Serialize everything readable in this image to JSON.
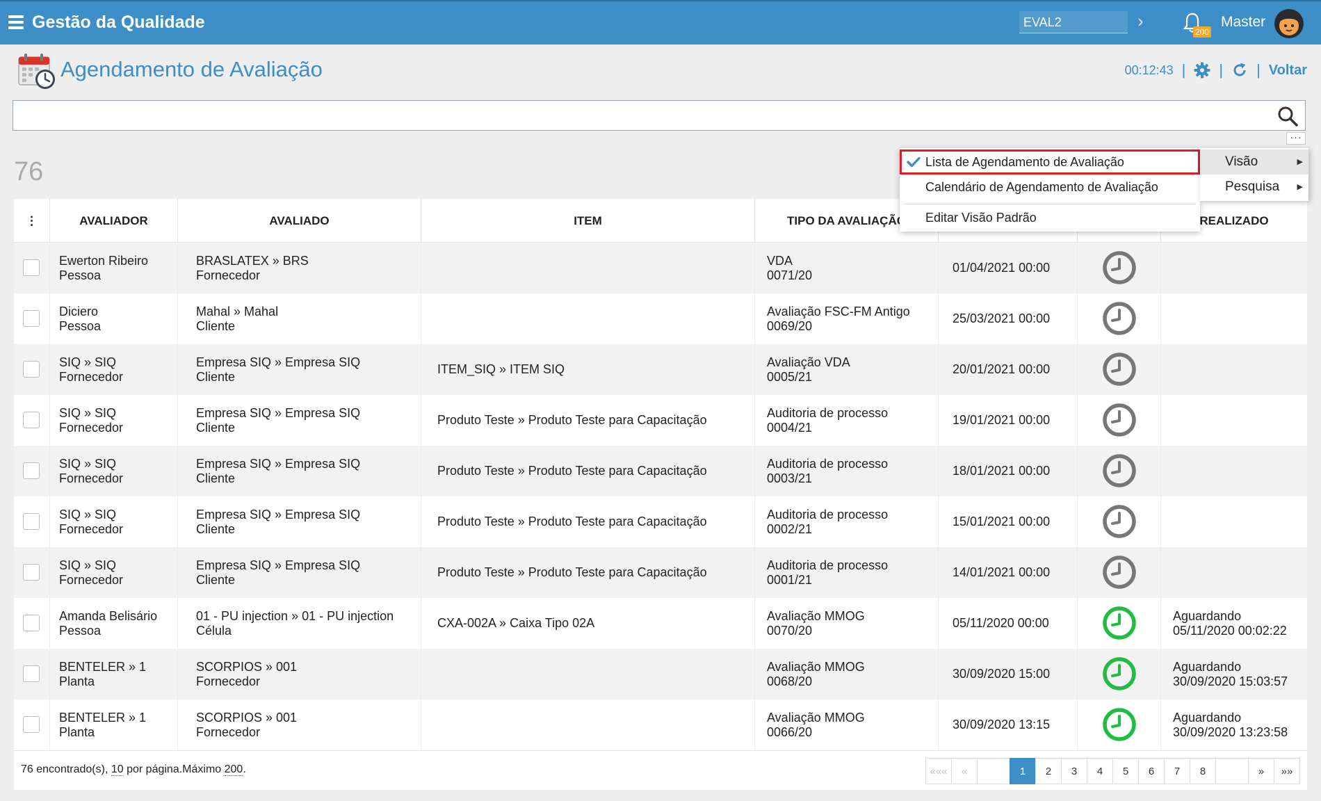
{
  "app": {
    "title": "Gestão da Qualidade",
    "environment": "EVAL2",
    "notification_count": "200",
    "user": "Master"
  },
  "header": {
    "title": "Agendamento de Avaliação",
    "timer": "00:12:43",
    "back_label": "Voltar"
  },
  "search": {
    "value": "",
    "placeholder": ""
  },
  "record_count": "76",
  "table": {
    "columns": [
      "AVALIADOR",
      "AVALIADO",
      "ITEM",
      "TIPO DA AVALIAÇÃO",
      "",
      "",
      "REALIZADO"
    ],
    "rows": [
      {
        "avaliador": [
          "Ewerton Ribeiro",
          "Pessoa"
        ],
        "avaliado": [
          "BRASLATEX » BRS",
          "Fornecedor"
        ],
        "item": "",
        "tipo": [
          "VDA",
          "0071/20"
        ],
        "data": "01/04/2021 00:00",
        "status": "pending",
        "realizado": [
          "",
          ""
        ]
      },
      {
        "avaliador": [
          "Diciero",
          "Pessoa"
        ],
        "avaliado": [
          "Mahal » Mahal",
          "Cliente"
        ],
        "item": "",
        "tipo": [
          "Avaliação FSC-FM Antigo",
          "0069/20"
        ],
        "data": "25/03/2021 00:00",
        "status": "pending",
        "realizado": [
          "",
          ""
        ]
      },
      {
        "avaliador": [
          "SIQ » SIQ",
          "Fornecedor"
        ],
        "avaliado": [
          "Empresa SIQ » Empresa SIQ",
          "Cliente"
        ],
        "item": "ITEM_SIQ » ITEM SIQ",
        "tipo": [
          "Avaliação VDA",
          "0005/21"
        ],
        "data": "20/01/2021 00:00",
        "status": "pending",
        "realizado": [
          "",
          ""
        ]
      },
      {
        "avaliador": [
          "SIQ » SIQ",
          "Fornecedor"
        ],
        "avaliado": [
          "Empresa SIQ » Empresa SIQ",
          "Cliente"
        ],
        "item": "Produto Teste » Produto Teste para Capacitação",
        "tipo": [
          "Auditoria de processo",
          "0004/21"
        ],
        "data": "19/01/2021 00:00",
        "status": "pending",
        "realizado": [
          "",
          ""
        ]
      },
      {
        "avaliador": [
          "SIQ » SIQ",
          "Fornecedor"
        ],
        "avaliado": [
          "Empresa SIQ » Empresa SIQ",
          "Cliente"
        ],
        "item": "Produto Teste » Produto Teste para Capacitação",
        "tipo": [
          "Auditoria de processo",
          "0003/21"
        ],
        "data": "18/01/2021 00:00",
        "status": "pending",
        "realizado": [
          "",
          ""
        ]
      },
      {
        "avaliador": [
          "SIQ » SIQ",
          "Fornecedor"
        ],
        "avaliado": [
          "Empresa SIQ » Empresa SIQ",
          "Cliente"
        ],
        "item": "Produto Teste » Produto Teste para Capacitação",
        "tipo": [
          "Auditoria de processo",
          "0002/21"
        ],
        "data": "15/01/2021 00:00",
        "status": "pending",
        "realizado": [
          "",
          ""
        ]
      },
      {
        "avaliador": [
          "SIQ » SIQ",
          "Fornecedor"
        ],
        "avaliado": [
          "Empresa SIQ » Empresa SIQ",
          "Cliente"
        ],
        "item": "Produto Teste » Produto Teste para Capacitação",
        "tipo": [
          "Auditoria de processo",
          "0001/21"
        ],
        "data": "14/01/2021 00:00",
        "status": "pending",
        "realizado": [
          "",
          ""
        ]
      },
      {
        "avaliador": [
          "Amanda Belisário",
          "Pessoa"
        ],
        "avaliado": [
          "01 - PU injection » 01 - PU injection",
          "Célula"
        ],
        "item": "CXA-002A » Caixa Tipo 02A",
        "tipo": [
          "Avaliação MMOG",
          "0070/20"
        ],
        "data": "05/11/2020 00:00",
        "status": "active",
        "realizado": [
          "Aguardando",
          "05/11/2020 00:02:22"
        ]
      },
      {
        "avaliador": [
          "BENTELER » 1",
          "Planta"
        ],
        "avaliado": [
          "SCORPIOS » 001",
          "Fornecedor"
        ],
        "item": "",
        "tipo": [
          "Avaliação MMOG",
          "0068/20"
        ],
        "data": "30/09/2020 15:00",
        "status": "active",
        "realizado": [
          "Aguardando",
          "30/09/2020 15:03:57"
        ]
      },
      {
        "avaliador": [
          "BENTELER » 1",
          "Planta"
        ],
        "avaliado": [
          "SCORPIOS » 001",
          "Fornecedor"
        ],
        "item": "",
        "tipo": [
          "Avaliação MMOG",
          "0066/20"
        ],
        "data": "30/09/2020 13:15",
        "status": "active",
        "realizado": [
          "Aguardando",
          "30/09/2020 13:23:58"
        ]
      }
    ]
  },
  "footer": {
    "found": "76",
    "found_suffix": " encontrado(s), ",
    "per_page": "10",
    "per_page_suffix": " por página.Máximo ",
    "max": "200",
    "max_suffix": "."
  },
  "pagination": [
    "«««",
    "«",
    "",
    "1",
    "2",
    "3",
    "4",
    "5",
    "6",
    "7",
    "8",
    "",
    "»",
    "»»"
  ],
  "menu": {
    "items": [
      "Lista de Agendamento de Avaliação",
      "Calendário de Agendamento de Avaliação",
      "Editar Visão Padrão"
    ],
    "side": [
      "Visão",
      "Pesquisa"
    ]
  },
  "colors": {
    "brand": "#3d8ec7",
    "pending": "#777777",
    "active": "#22bb44",
    "highlight": "#e01b24",
    "badge": "#f5a623"
  },
  "icons": [
    "menu-icon",
    "chevron-right-icon",
    "bell-icon",
    "avatar",
    "calendar-clock-icon",
    "gear-icon",
    "refresh-icon",
    "search-icon",
    "more-icon",
    "clock-icon",
    "check-icon",
    "caret-right-icon"
  ]
}
